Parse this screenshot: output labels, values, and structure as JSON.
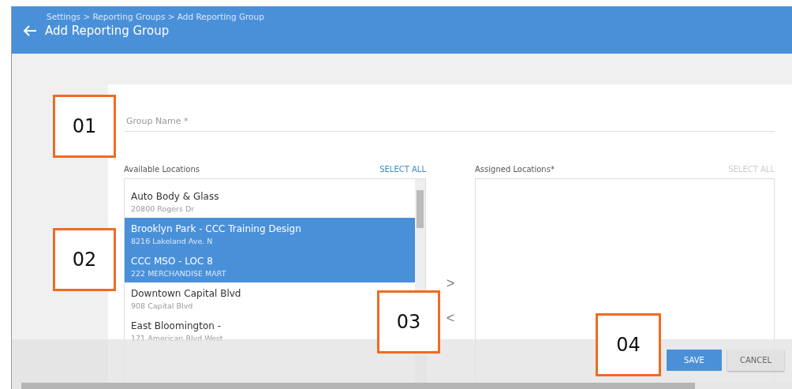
{
  "header": {
    "breadcrumb": "Settings > Reporting Groups > Add Reporting Group",
    "title": "Add Reporting Group"
  },
  "group_name": {
    "placeholder": "Group Name *"
  },
  "available": {
    "label": "Available Locations",
    "select_all": "SELECT ALL",
    "items": [
      {
        "name": "Auto Body & Glass",
        "address": "20800 Rogers Dr",
        "selected": false
      },
      {
        "name": "Brooklyn Park - CCC Training Design",
        "address": "8216 Lakeland Ave. N",
        "selected": true
      },
      {
        "name": "CCC MSO - LOC 8",
        "address": "222 MERCHANDISE MART",
        "selected": true
      },
      {
        "name": "Downtown Capital Blvd",
        "address": "908 Capital Blvd",
        "selected": false
      },
      {
        "name": "East Bloomington -",
        "address": "171 American Blvd West",
        "selected": false
      }
    ]
  },
  "move_buttons": [
    {
      "symbol": ">"
    },
    {
      "symbol": "<"
    }
  ],
  "assigned": {
    "label": "Assigned Locations*",
    "select_all": "SELECT ALL",
    "disabled": true
  },
  "buttons": [
    {
      "label": "SAVE",
      "kind": "primary"
    },
    {
      "label": "CANCEL",
      "kind": "secondary"
    }
  ],
  "callouts": [
    {
      "label": "01"
    },
    {
      "label": "02"
    },
    {
      "label": "03"
    },
    {
      "label": "04"
    }
  ]
}
